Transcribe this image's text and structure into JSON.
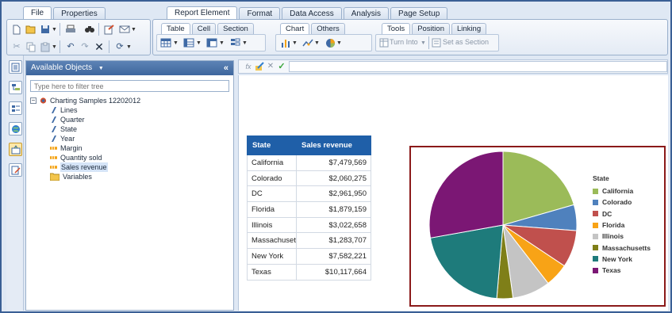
{
  "top_tabs": {
    "file": "File",
    "properties": "Properties"
  },
  "ribbon_tabs": [
    "Report Element",
    "Format",
    "Data Access",
    "Analysis",
    "Page Setup"
  ],
  "sub_tabs": {
    "table": "Table",
    "cell": "Cell",
    "section": "Section",
    "chart": "Chart",
    "others": "Others",
    "tools": "Tools",
    "position": "Position",
    "linking": "Linking"
  },
  "tools": {
    "turn_into": "Turn Into",
    "set_as_section": "Set as Section"
  },
  "icons": {
    "new": "new-document-icon",
    "open": "open-folder-icon",
    "save": "save-icon",
    "print": "print-icon",
    "find": "find-icon",
    "track": "track-changes-icon",
    "email": "email-icon",
    "cut": "cut-icon",
    "copy": "copy-icon",
    "paste": "paste-icon",
    "undo": "undo-icon",
    "redo": "redo-icon",
    "delete": "delete-icon",
    "refresh": "refresh-icon",
    "fx": "formula-icon",
    "validate": "check-icon",
    "cancel": "cancel-icon"
  },
  "object_panel": {
    "title": "Available Objects",
    "filter_placeholder": "Type here to filter tree",
    "root": "Charting Samples 12202012",
    "items": [
      "Lines",
      "Quarter",
      "State",
      "Year",
      "Margin",
      "Quantity sold",
      "Sales revenue",
      "Variables"
    ]
  },
  "table": {
    "headers": [
      "State",
      "Sales revenue"
    ],
    "rows": [
      [
        "California",
        "$7,479,569"
      ],
      [
        "Colorado",
        "$2,060,275"
      ],
      [
        "DC",
        "$2,961,950"
      ],
      [
        "Florida",
        "$1,879,159"
      ],
      [
        "Illinois",
        "$3,022,658"
      ],
      [
        "Massachusetts",
        "$1,283,707"
      ],
      [
        "New York",
        "$7,582,221"
      ],
      [
        "Texas",
        "$10,117,664"
      ]
    ]
  },
  "chart_data": {
    "type": "pie",
    "legend_title": "State",
    "legend_position": "right",
    "categories": [
      "California",
      "Colorado",
      "DC",
      "Florida",
      "Illinois",
      "Massachusetts",
      "New York",
      "Texas"
    ],
    "values": [
      7479569,
      2060275,
      2961950,
      1879159,
      3022658,
      1283707,
      7582221,
      10117664
    ],
    "colors": [
      "#9bbb59",
      "#4f81bd",
      "#c0504d",
      "#f8a316",
      "#c4c4c4",
      "#7f7f18",
      "#1e7b7b",
      "#7b1774"
    ]
  }
}
